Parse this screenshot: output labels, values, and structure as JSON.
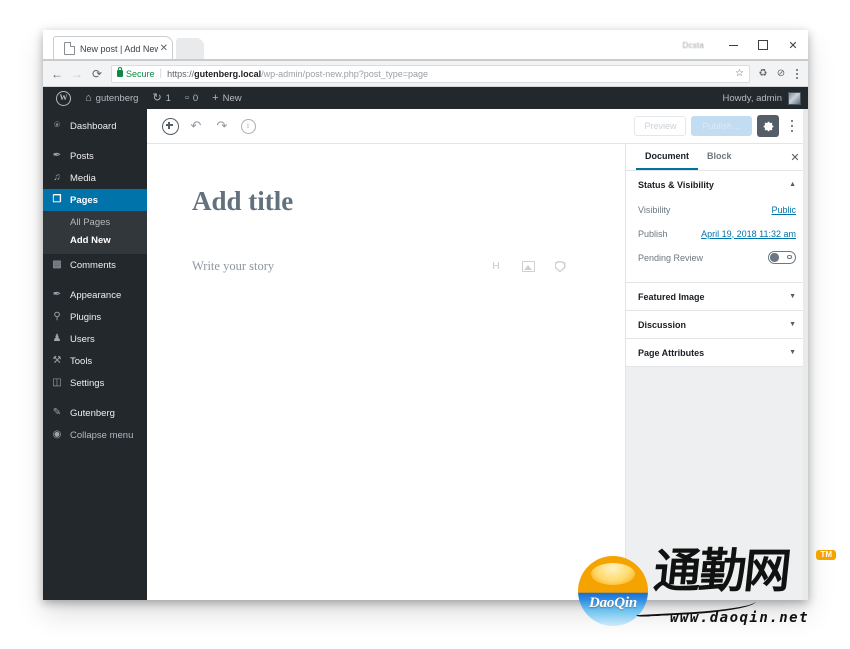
{
  "browser": {
    "tab": {
      "title": "New post | Add New Pag",
      "close_label": "✕",
      "page_icon": "page-icon"
    },
    "window_badge": "Dcsta",
    "controls": {
      "minimize": "—",
      "maximize": "□",
      "close": "✕"
    },
    "nav": {
      "back": "←",
      "forward": "→",
      "reload": "⟳"
    },
    "omnibox": {
      "security_label": "Secure",
      "separator": "|",
      "url_scheme": "https://",
      "url_host": "gutenberg.local",
      "url_path": "/wp-admin/post-new.php?post_type=page",
      "star": "☆",
      "extension_1": "♻",
      "extension_2": "⊘",
      "menu": "kebab-menu"
    }
  },
  "adminbar": {
    "logo": "W",
    "site_name": "gutenberg",
    "updates_icon": "↻",
    "updates_count": "1",
    "comments_icon": "💬",
    "comments_count": "0",
    "new_icon": "+",
    "new_label": "New",
    "howdy": "Howdy, admin"
  },
  "adminmenu": {
    "items": [
      {
        "label": "Dashboard",
        "icon": "⌘",
        "current": false
      },
      {
        "label": "Posts",
        "icon": "✎",
        "current": false
      },
      {
        "label": "Media",
        "icon": "♫",
        "current": false
      },
      {
        "label": "Pages",
        "icon": "❐",
        "current": true
      },
      {
        "label": "Comments",
        "icon": "▢",
        "current": false
      },
      {
        "label": "Appearance",
        "icon": "✒",
        "current": false
      },
      {
        "label": "Plugins",
        "icon": "⚓",
        "current": false
      },
      {
        "label": "Users",
        "icon": "♟",
        "current": false
      },
      {
        "label": "Tools",
        "icon": "⚒",
        "current": false
      },
      {
        "label": "Settings",
        "icon": "☷",
        "current": false
      },
      {
        "label": "Gutenberg",
        "icon": "✏",
        "current": false
      },
      {
        "label": "Collapse menu",
        "icon": "◉",
        "current": false
      }
    ],
    "pages_submenu": [
      {
        "label": "All Pages",
        "current": false
      },
      {
        "label": "Add New",
        "current": true
      }
    ]
  },
  "editor": {
    "toolbar": {
      "inserter_label": "Add block",
      "undo_label": "↶",
      "redo_label": "↷",
      "info_label": "i",
      "preview_label": "Preview",
      "publish_label": "Publish…",
      "settings_label": "Settings",
      "more_label": "More"
    },
    "canvas": {
      "title_placeholder": "Add title",
      "body_placeholder": "Write your story",
      "quick_inserters": [
        {
          "name": "heading-inserter",
          "glyph": "H"
        },
        {
          "name": "image-inserter",
          "glyph": ""
        },
        {
          "name": "quote-inserter",
          "glyph": ""
        }
      ]
    }
  },
  "settings_sidebar": {
    "tabs": [
      {
        "label": "Document",
        "active": true
      },
      {
        "label": "Block",
        "active": false
      }
    ],
    "close_label": "✕",
    "panels": [
      {
        "title": "Status & Visibility",
        "open": true,
        "arrow": "▲",
        "rows": [
          {
            "label": "Visibility",
            "value": "Public",
            "type": "link"
          },
          {
            "label": "Publish",
            "value": "April 19, 2018 11:32 am",
            "type": "link"
          },
          {
            "label": "Pending Review",
            "value": "off",
            "type": "toggle"
          }
        ]
      },
      {
        "title": "Featured Image",
        "open": false,
        "arrow": "▼",
        "rows": []
      },
      {
        "title": "Discussion",
        "open": false,
        "arrow": "▼",
        "rows": []
      },
      {
        "title": "Page Attributes",
        "open": false,
        "arrow": "▼",
        "rows": []
      }
    ]
  },
  "watermark": {
    "ball_text": "DaoQin",
    "chinese_text": "通勤网",
    "tm": "TM",
    "url": "www.daoqin.net"
  },
  "colors": {
    "wp_blue": "#0073aa",
    "admin_dark": "#23282d",
    "submenu_dark": "#32373c",
    "sidebar_gray": "#edeff0",
    "secure_green": "#0f8a46",
    "watermark_orange": "#f5a300"
  }
}
